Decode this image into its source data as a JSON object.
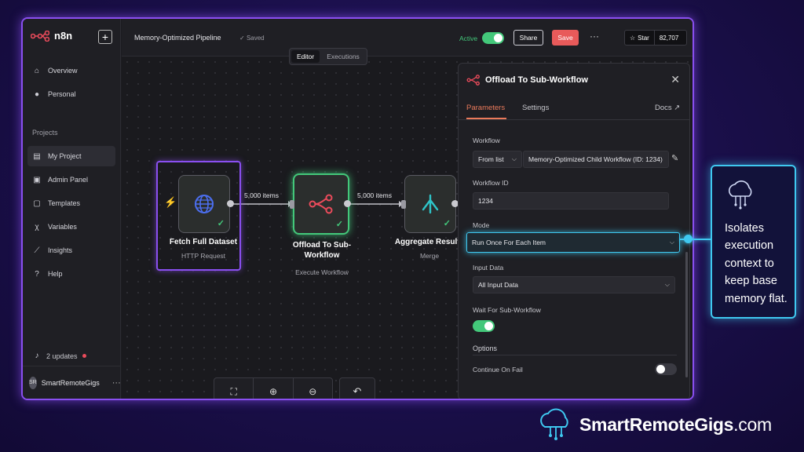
{
  "app": {
    "logo_text": "n8n",
    "workflow_name": "Memory-Optimized Pipeline",
    "saved_status": "Saved",
    "active_label": "Active",
    "share_label": "Share",
    "save_label": "Save",
    "star_label": "Star",
    "star_count": "82,707"
  },
  "editor_tabs": [
    {
      "label": "Editor",
      "active": true
    },
    {
      "label": "Executions",
      "active": false
    }
  ],
  "sidebar": {
    "items": [
      {
        "label": "Overview",
        "icon": "home-icon"
      },
      {
        "label": "Personal",
        "icon": "user-icon"
      }
    ],
    "projects_label": "Projects",
    "project_items": [
      {
        "label": "My Project",
        "icon": "clipboard-icon",
        "active": true
      },
      {
        "label": "Admin Panel",
        "icon": "panel-icon"
      },
      {
        "label": "Templates",
        "icon": "box-icon"
      },
      {
        "label": "Variables",
        "icon": "variable-icon"
      },
      {
        "label": "Insights",
        "icon": "chart-icon"
      },
      {
        "label": "Help",
        "icon": "help-icon"
      }
    ],
    "updates_label": "2 updates",
    "user_initials": "SR",
    "user_name": "SmartRemoteGigs"
  },
  "nodes": [
    {
      "title": "Fetch Full Dataset",
      "subtitle": "HTTP Request",
      "icon": "globe-icon"
    },
    {
      "title": "Offload To Sub-Workflow",
      "subtitle": "Execute Workflow",
      "icon": "subworkflow-icon"
    },
    {
      "title": "Aggregate Results",
      "subtitle": "Merge",
      "icon": "merge-icon"
    }
  ],
  "connections": [
    {
      "label": "5,000 items"
    },
    {
      "label": "5,000 items"
    }
  ],
  "panel": {
    "title": "Offload To Sub-Workflow",
    "tabs": {
      "parameters": "Parameters",
      "settings": "Settings",
      "docs": "Docs"
    },
    "workflow_label": "Workflow",
    "workflow_source": "From list",
    "workflow_value": "Memory-Optimized Child Workflow (ID: 1234)",
    "workflow_id_label": "Workflow ID",
    "workflow_id_value": "1234",
    "mode_label": "Mode",
    "mode_value": "Run Once For Each Item",
    "input_data_label": "Input Data",
    "input_data_value": "All Input Data",
    "wait_label": "Wait For Sub-Workflow",
    "wait_enabled": true,
    "options_label": "Options",
    "continue_label": "Continue On Fail",
    "continue_enabled": false
  },
  "callout": {
    "text": "Isolates execution context to keep base memory flat."
  },
  "brand": {
    "name": "SmartRemoteGigs",
    "domain": ".com"
  },
  "colors": {
    "accent_purple": "#8a4ff0",
    "accent_cyan": "#3fc8f0",
    "save_red": "#e85a5a",
    "active_green": "#43c87a",
    "n8n_orange": "#ea4b5b"
  }
}
